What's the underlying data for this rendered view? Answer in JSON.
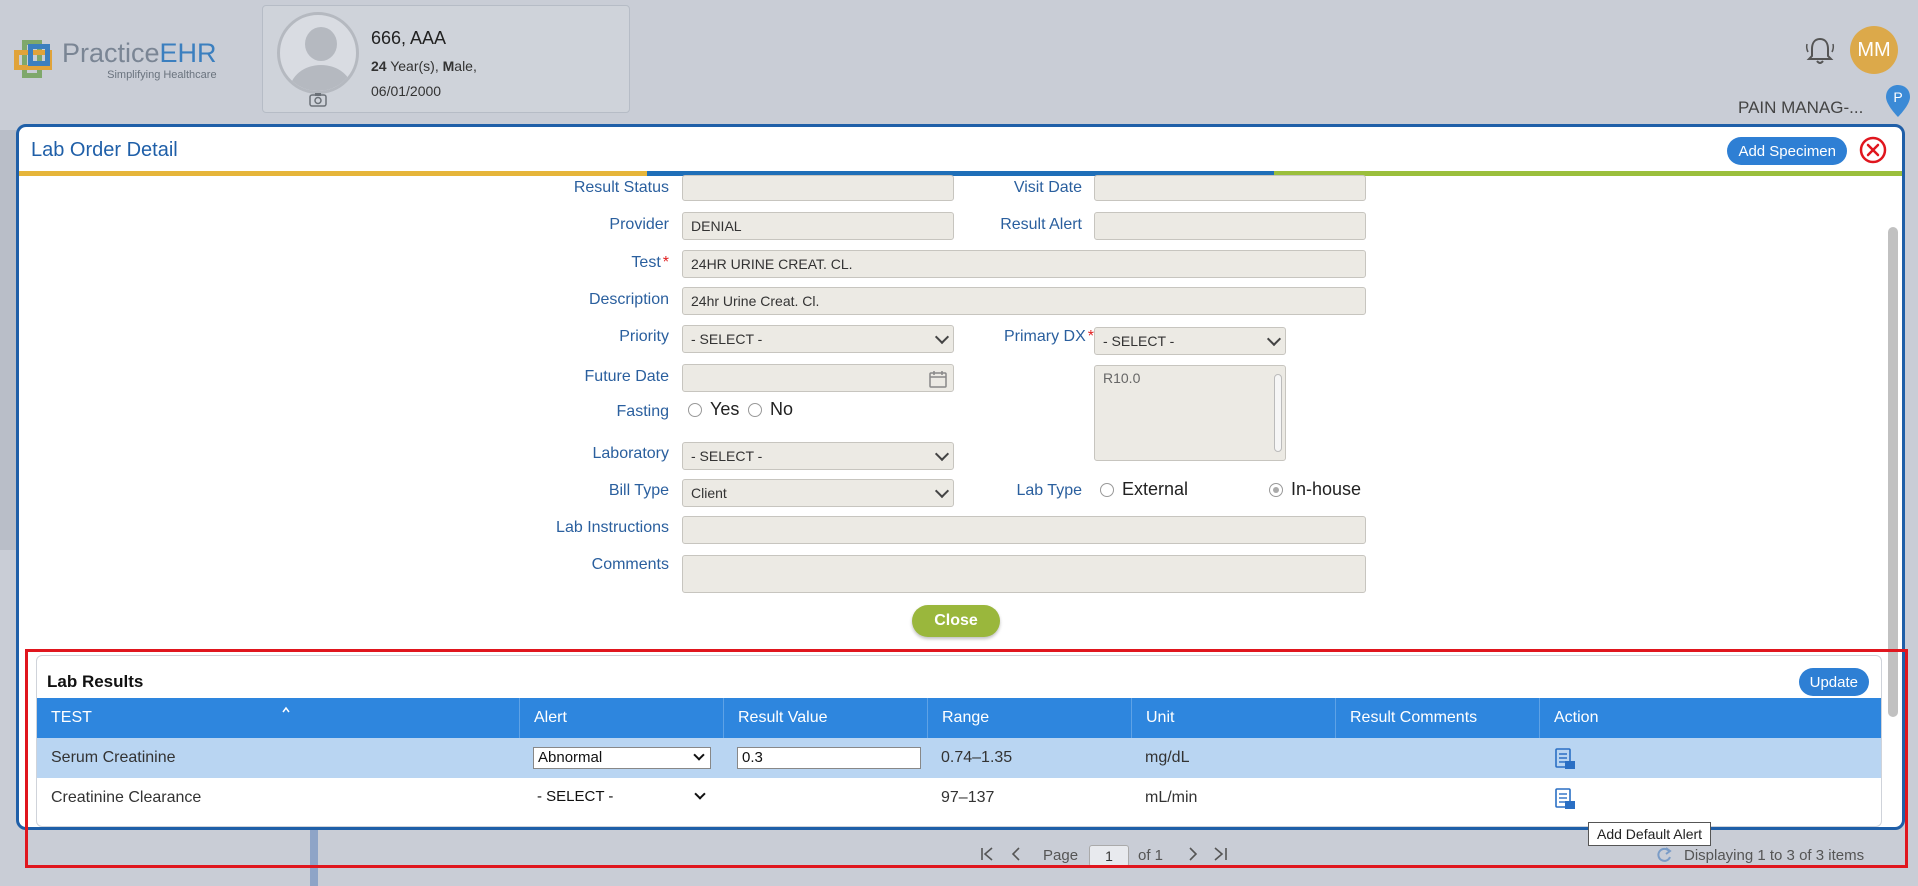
{
  "app": {
    "logo_name_part1": "Practice",
    "logo_name_part2": "EHR",
    "logo_tagline": "Simplifying Healthcare",
    "user_initials": "MM",
    "facility": "PAIN MANAG-..."
  },
  "patient": {
    "name": "666, AAA",
    "age_bold": "24",
    "age_rest": " Year(s), ",
    "sex_bold": "M",
    "sex_rest": "ale,",
    "dob": "06/01/2000"
  },
  "modal": {
    "title": "Lab Order Detail",
    "add_specimen_label": "Add Specimen",
    "close_label": "Close",
    "colors": {
      "stripe1": "#e6b53a",
      "stripe2": "#1f6fb8",
      "stripe3": "#9bbf3c"
    }
  },
  "form": {
    "result_status": {
      "label": "Result Status",
      "value": ""
    },
    "visit_date": {
      "label": "Visit Date",
      "value": ""
    },
    "provider": {
      "label": "Provider",
      "value": "DENIAL"
    },
    "result_alert": {
      "label": "Result Alert",
      "value": ""
    },
    "test": {
      "label": "Test",
      "value": "24HR URINE CREAT. CL."
    },
    "description": {
      "label": "Description",
      "value": "24hr Urine Creat. Cl."
    },
    "priority": {
      "label": "Priority",
      "value": "- SELECT -"
    },
    "primary_dx": {
      "label": "Primary DX",
      "value": "- SELECT -",
      "list": "R10.0"
    },
    "future_date": {
      "label": "Future Date",
      "value": ""
    },
    "fasting": {
      "label": "Fasting",
      "yes": "Yes",
      "no": "No"
    },
    "laboratory": {
      "label": "Laboratory",
      "value": "- SELECT -"
    },
    "bill_type": {
      "label": "Bill Type",
      "value": "Client"
    },
    "lab_type": {
      "label": "Lab Type",
      "external": "External",
      "inhouse": "In-house",
      "selected": "In-house"
    },
    "lab_instructions": {
      "label": "Lab Instructions",
      "value": ""
    },
    "comments": {
      "label": "Comments",
      "value": ""
    }
  },
  "lab_results": {
    "title": "Lab Results",
    "update_label": "Update",
    "columns": [
      "TEST",
      "Alert",
      "Result Value",
      "Range",
      "Unit",
      "Result Comments",
      "Action"
    ],
    "rows": [
      {
        "test": "Serum Creatinine",
        "alert": "Abnormal",
        "result_value": "0.3",
        "range": "0.74–1.35",
        "unit": "mg/dL",
        "comments": ""
      },
      {
        "test": "Creatinine Clearance",
        "alert": "- SELECT -",
        "result_value": "",
        "range": "97–137",
        "unit": "mL/min",
        "comments": ""
      }
    ],
    "tooltip": "Add Default Alert"
  },
  "pager": {
    "page_label": "Page",
    "page": "1",
    "of_label": "of 1",
    "summary": "Displaying 1 to 3 of 3 items"
  }
}
